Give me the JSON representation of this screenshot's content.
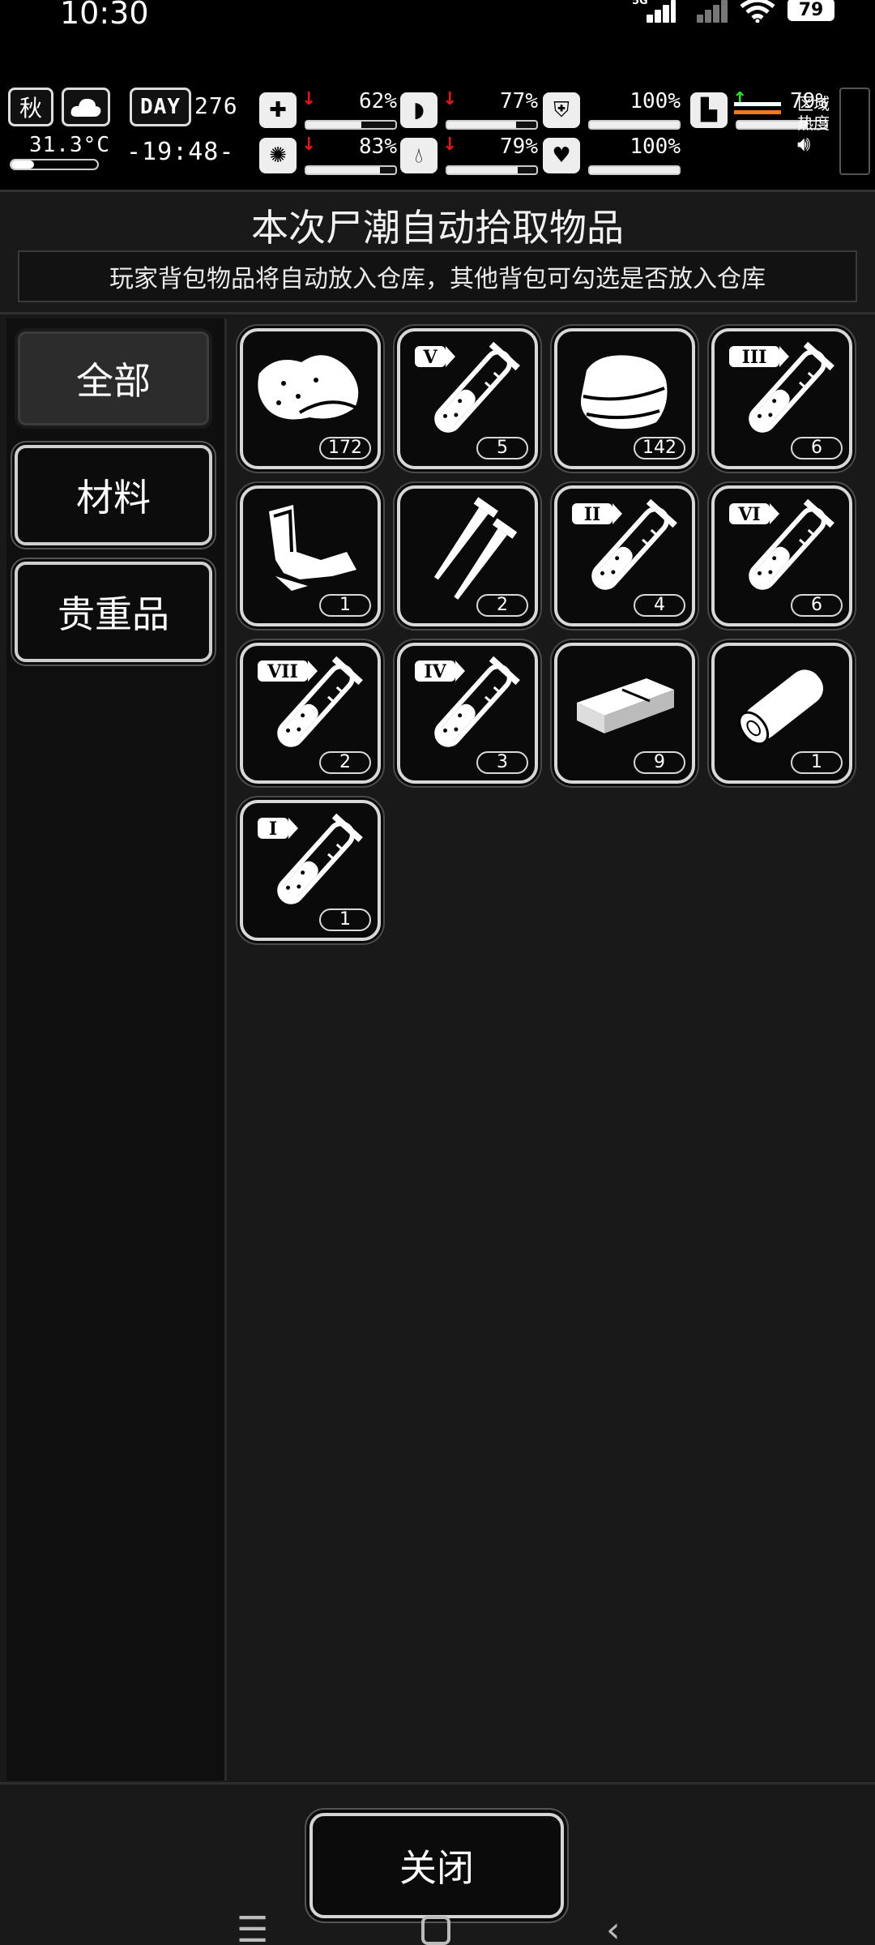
{
  "status_bar": {
    "time": "10:30",
    "signal1_label": "5G",
    "battery": "79"
  },
  "hud": {
    "season": "秋",
    "weather_icon": "cloud-icon",
    "temperature": "31.3°C",
    "day_label": "DAY",
    "day_number": "276",
    "clock": "-19:48-",
    "stats": [
      {
        "name": "health",
        "icon": "medkit-icon",
        "trend": "down",
        "value": "62%",
        "level": 0.62
      },
      {
        "name": "hunger",
        "icon": "stomach-icon",
        "trend": "down",
        "value": "77%",
        "level": 0.77
      },
      {
        "name": "armor",
        "icon": "armor-icon",
        "trend": "",
        "value": "100%",
        "level": 1.0
      },
      {
        "name": "sanity",
        "icon": "brain-icon",
        "trend": "down",
        "value": "83%",
        "level": 0.83
      },
      {
        "name": "thirst",
        "icon": "water-drop-icon",
        "trend": "down",
        "value": "79%",
        "level": 0.79
      },
      {
        "name": "heart",
        "icon": "heart-icon",
        "trend": "",
        "value": "100%",
        "level": 1.0
      },
      {
        "name": "stamina",
        "icon": "foot-icon",
        "trend": "up",
        "value": "79%",
        "level": 0.79
      }
    ],
    "region_label_1": "区域",
    "region_label_2": "热度"
  },
  "dialog": {
    "title": "本次尸潮自动拾取物品",
    "subtitle": "玩家背包物品将自动放入仓库，其他背包可勾选是否放入仓库",
    "tabs": [
      {
        "label": "全部",
        "active": true
      },
      {
        "label": "材料",
        "active": false
      },
      {
        "label": "贵重品",
        "active": false
      }
    ],
    "items": [
      {
        "icon": "meat-icon",
        "count": "172"
      },
      {
        "icon": "test-tube-v-icon",
        "tier": "V",
        "count": "5"
      },
      {
        "icon": "cloth-icon",
        "count": "142"
      },
      {
        "icon": "test-tube-iii-icon",
        "tier": "III",
        "count": "6"
      },
      {
        "icon": "scrap-metal-icon",
        "count": "1"
      },
      {
        "icon": "nails-icon",
        "count": "2"
      },
      {
        "icon": "test-tube-ii-icon",
        "tier": "II",
        "count": "4"
      },
      {
        "icon": "test-tube-vi-icon",
        "tier": "VI",
        "count": "6"
      },
      {
        "icon": "test-tube-vii-icon",
        "tier": "VII",
        "count": "2"
      },
      {
        "icon": "test-tube-iv-icon",
        "tier": "IV",
        "count": "3"
      },
      {
        "icon": "wood-plank-icon",
        "count": "9"
      },
      {
        "icon": "log-icon",
        "count": "1"
      },
      {
        "icon": "test-tube-i-icon",
        "tier": "I",
        "count": "1"
      }
    ],
    "close_label": "关闭"
  }
}
